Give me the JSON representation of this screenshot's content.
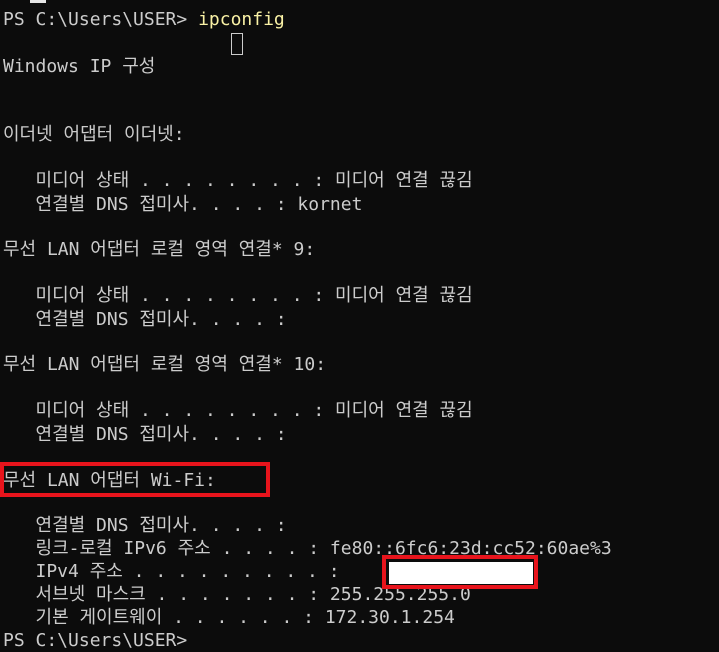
{
  "terminal": {
    "prompt": "PS C:\\Users\\USER>",
    "command": "ipconfig",
    "lines": {
      "title": "Windows IP 구성",
      "eth_header": "이더넷 어댑터 이더넷:",
      "eth_media": "   미디어 상태 . . . . . . . . : 미디어 연결 끊김",
      "eth_dns": "   연결별 DNS 접미사. . . . : kornet",
      "lan9_header": "무선 LAN 어댑터 로컬 영역 연결* 9:",
      "lan9_media": "   미디어 상태 . . . . . . . . : 미디어 연결 끊김",
      "lan9_dns": "   연결별 DNS 접미사. . . . :",
      "lan10_header": "무선 LAN 어댑터 로컬 영역 연결* 10:",
      "lan10_media": "   미디어 상태 . . . . . . . . : 미디어 연결 끊김",
      "lan10_dns": "   연결별 DNS 접미사. . . . :",
      "wifi_header": "무선 LAN 어댑터 Wi-Fi:",
      "wifi_dns": "   연결별 DNS 접미사. . . . :",
      "wifi_ipv6": "   링크-로컬 IPv6 주소 . . . . : fe80::6fc6:23d:cc52:60ae%3",
      "wifi_ipv4": "   IPv4 주소 . . . . . . . . . :",
      "wifi_subnet": "   서브넷 마스크 . . . . . . . : 255.255.255.0",
      "wifi_gateway": "   기본 게이트웨이 . . . . . . : 172.30.1.254"
    },
    "prompt_end": "PS C:\\Users\\USER>"
  },
  "colors": {
    "background": "#0c0c0c",
    "text": "#cccccc",
    "command": "#f9f1a5",
    "highlight": "#e8141c",
    "redaction": "#ffffff"
  }
}
